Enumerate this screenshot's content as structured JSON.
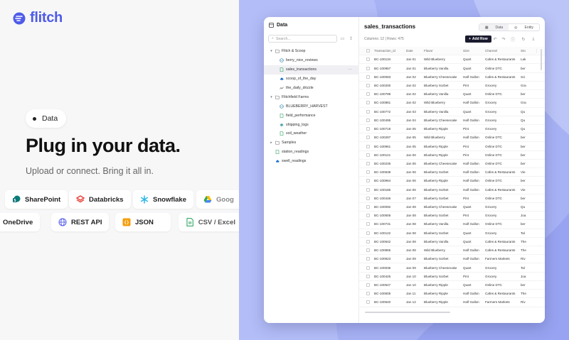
{
  "brand": {
    "name": "flitch",
    "color": "#4f5be8"
  },
  "hero": {
    "pill_label": "Data",
    "headline": "Plug in your data.",
    "subline": "Upload or connect. Bring it all in."
  },
  "connectors": [
    {
      "label": "SharePoint",
      "icon": "sharepoint-icon"
    },
    {
      "label": "Databricks",
      "icon": "databricks-icon"
    },
    {
      "label": "Snowflake",
      "icon": "snowflake-icon"
    },
    {
      "label": "Goog",
      "icon": "google-drive-icon"
    },
    {
      "label": "OneDrive",
      "icon": "onedrive-icon"
    },
    {
      "label": "REST API",
      "icon": "globe-icon"
    },
    {
      "label": "JSON",
      "icon": "json-icon"
    },
    {
      "label": "CSV / Excel",
      "icon": "csv-icon"
    }
  ],
  "app": {
    "sidebar": {
      "title": "Data",
      "search_placeholder": "Search...",
      "tree": [
        {
          "label": "Flitch & Scoop",
          "type": "folder",
          "level": 0,
          "expanded": true
        },
        {
          "label": "berry_nice_reviews",
          "type": "api",
          "level": 1
        },
        {
          "label": "sales_transactions",
          "type": "file",
          "level": 1,
          "selected": true
        },
        {
          "label": "scoop_of_the_day",
          "type": "cloud",
          "level": 1
        },
        {
          "label": "the_daily_drizzle",
          "type": "sheet",
          "level": 1
        },
        {
          "label": "Flitchfield Farms",
          "type": "folder",
          "level": 0,
          "expanded": true
        },
        {
          "label": "BLUEBERRY_HARVEST",
          "type": "api",
          "level": 1
        },
        {
          "label": "field_performance",
          "type": "file",
          "level": 1
        },
        {
          "label": "shipping_logs",
          "type": "snow",
          "level": 1
        },
        {
          "label": "soil_weather",
          "type": "file",
          "level": 1
        },
        {
          "label": "Samples",
          "type": "folder",
          "level": 0,
          "expanded": false
        },
        {
          "label": "station_readings",
          "type": "file",
          "level": 0
        },
        {
          "label": "swell_readings",
          "type": "cloud",
          "level": 0
        }
      ]
    },
    "main": {
      "title": "sales_transactions",
      "tabs": [
        "Data",
        "Entity"
      ],
      "active_tab": "Data",
      "meta": "Columns: 12 | Rows: 475",
      "add_row_label": "Add Row",
      "columns": [
        "Transaction_id",
        "Date",
        "Flavor",
        "Size",
        "Channel",
        "Sto"
      ],
      "rows": [
        [
          "BC-100134",
          "Jan 01",
          "Wild Blueberry",
          "Quart",
          "Cafes & Restaurants",
          "Lak"
        ],
        [
          "BC-100957",
          "Jan 01",
          "Blueberry Vanilla",
          "Quart",
          "Online DTC",
          "ber"
        ],
        [
          "BC-100083",
          "Jan 02",
          "Blueberry Cheesecake",
          "Half Gallon",
          "Cafes & Restaurants",
          "Sci"
        ],
        [
          "BC-100200",
          "Jan 02",
          "Blueberry Sorbet",
          "Pint",
          "Grocery",
          "Gra"
        ],
        [
          "BC-100798",
          "Jan 02",
          "Blueberry Vanilla",
          "Quart",
          "Online DTC",
          "ber"
        ],
        [
          "BC-100881",
          "Jan 02",
          "Wild Blueberry",
          "Half Gallon",
          "Grocery",
          "Gra"
        ],
        [
          "BC-100772",
          "Jan 03",
          "Blueberry Vanilla",
          "Quart",
          "Grocery",
          "Qu"
        ],
        [
          "BC-100495",
          "Jan 04",
          "Blueberry Cheesecake",
          "Half Gallon",
          "Grocery",
          "Qu"
        ],
        [
          "BC-100718",
          "Jan 05",
          "Blueberry Ripple",
          "Pint",
          "Grocery",
          "Qu"
        ],
        [
          "BC-100287",
          "Jan 05",
          "Wild Blueberry",
          "Half Gallon",
          "Online DTC",
          "ber"
        ],
        [
          "BC-100961",
          "Jan 05",
          "Blueberry Ripple",
          "Pint",
          "Online DTC",
          "ber"
        ],
        [
          "BC-100121",
          "Jan 06",
          "Blueberry Ripple",
          "Pint",
          "Online DTC",
          "ber"
        ],
        [
          "BC-100236",
          "Jan 06",
          "Blueberry Cheesecake",
          "Half Gallon",
          "Online DTC",
          "ber"
        ],
        [
          "BC-100638",
          "Jan 06",
          "Blueberry Sorbet",
          "Half Gallon",
          "Cafes & Restaurants",
          "Vie"
        ],
        [
          "BC-100964",
          "Jan 06",
          "Blueberry Ripple",
          "Half Gallon",
          "Online DTC",
          "ber"
        ],
        [
          "BC-100186",
          "Jan 06",
          "Blueberry Sorbet",
          "Half Gallon",
          "Cafes & Restaurants",
          "Vie"
        ],
        [
          "BC-100446",
          "Jan 07",
          "Blueberry Sorbet",
          "Pint",
          "Online DTC",
          "ber"
        ],
        [
          "BC-100092",
          "Jan 08",
          "Blueberry Cheesecake",
          "Quart",
          "Grocery",
          "Qu"
        ],
        [
          "BC-100606",
          "Jan 08",
          "Blueberry Sorbet",
          "Pint",
          "Grocery",
          "Joa"
        ],
        [
          "BC-100731",
          "Jan 08",
          "Blueberry Vanilla",
          "Half Gallon",
          "Online DTC",
          "ber"
        ],
        [
          "BC-100122",
          "Jan 08",
          "Blueberry Sorbet",
          "Quart",
          "Grocery",
          "Tal"
        ],
        [
          "BC-100542",
          "Jan 08",
          "Blueberry Vanilla",
          "Quart",
          "Cafes & Restaurants",
          "The"
        ],
        [
          "BC-100865",
          "Jan 08",
          "Wild Blueberry",
          "Half Gallon",
          "Cafes & Restaurants",
          "The"
        ],
        [
          "BC-100923",
          "Jan 09",
          "Blueberry Sorbet",
          "Half Gallon",
          "Farmers Markets",
          "Riv"
        ],
        [
          "BC-100036",
          "Jan 09",
          "Blueberry Cheesecake",
          "Quart",
          "Grocery",
          "Tal"
        ],
        [
          "BC-100425",
          "Jan 10",
          "Blueberry Sorbet",
          "Pint",
          "Grocery",
          "Joa"
        ],
        [
          "BC-100547",
          "Jan 10",
          "Blueberry Ripple",
          "Quart",
          "Online DTC",
          "ber"
        ],
        [
          "BC-100605",
          "Jan 11",
          "Blueberry Ripple",
          "Half Gallon",
          "Cafes & Restaurants",
          "The"
        ],
        [
          "BC-100540",
          "Jan 12",
          "Blueberry Ripple",
          "Half Gallon",
          "Farmers Markets",
          "Riv"
        ]
      ]
    }
  }
}
